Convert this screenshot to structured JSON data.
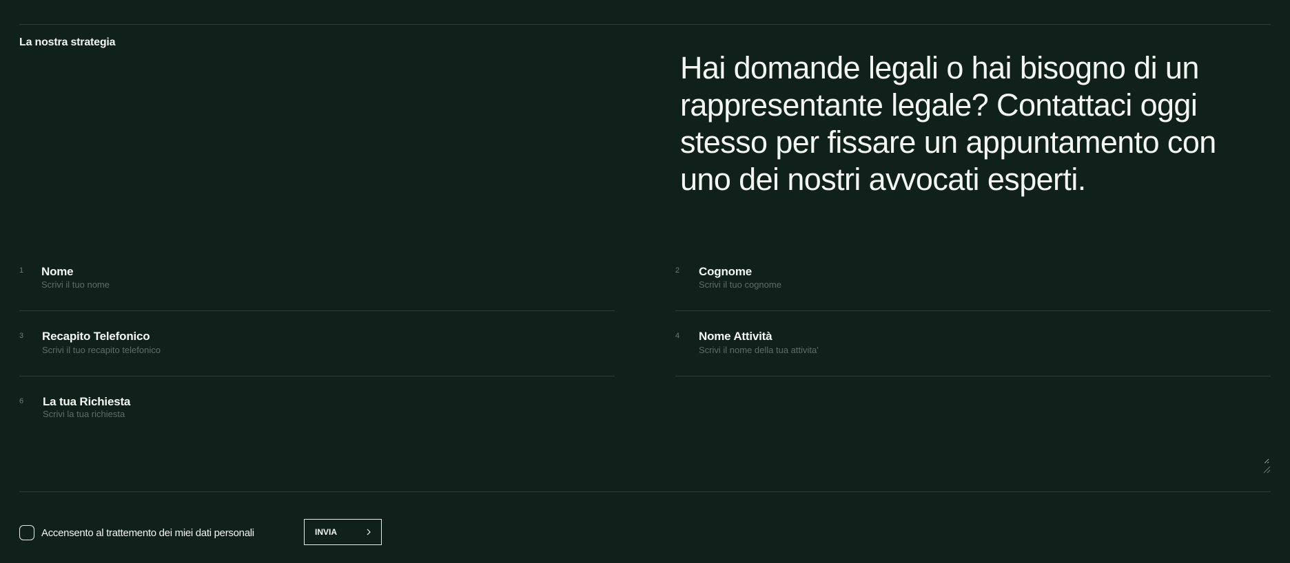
{
  "section": {
    "label": "La nostra strategia"
  },
  "headline": "Hai domande legali o hai bisogno di un rappresentante legale? Contattaci oggi stesso per fissare un appuntamento con uno dei nostri avvocati esperti.",
  "form": {
    "fields": [
      {
        "number": "1",
        "label": "Nome",
        "placeholder": "Scrivi il tuo nome"
      },
      {
        "number": "2",
        "label": "Cognome",
        "placeholder": "Scrivi il tuo cognome"
      },
      {
        "number": "3",
        "label": "Recapito Telefonico",
        "placeholder": "Scrivi il tuo recapito telefonico"
      },
      {
        "number": "4",
        "label": "Nome Attività",
        "placeholder": "Scrivi il nome della tua attivita'"
      },
      {
        "number": "6",
        "label": "La tua Richiesta",
        "placeholder": "Scrivi la tua richiesta"
      }
    ],
    "consent_label": "Accensento al trattemento dei miei dati personali",
    "submit_label": "INVIA",
    "submit_icon": "chevron-right-icon"
  },
  "colors": {
    "background": "#10201b",
    "text": "#f4f6f3",
    "divider": "#2c3c36",
    "placeholder": "#5e6d67"
  }
}
